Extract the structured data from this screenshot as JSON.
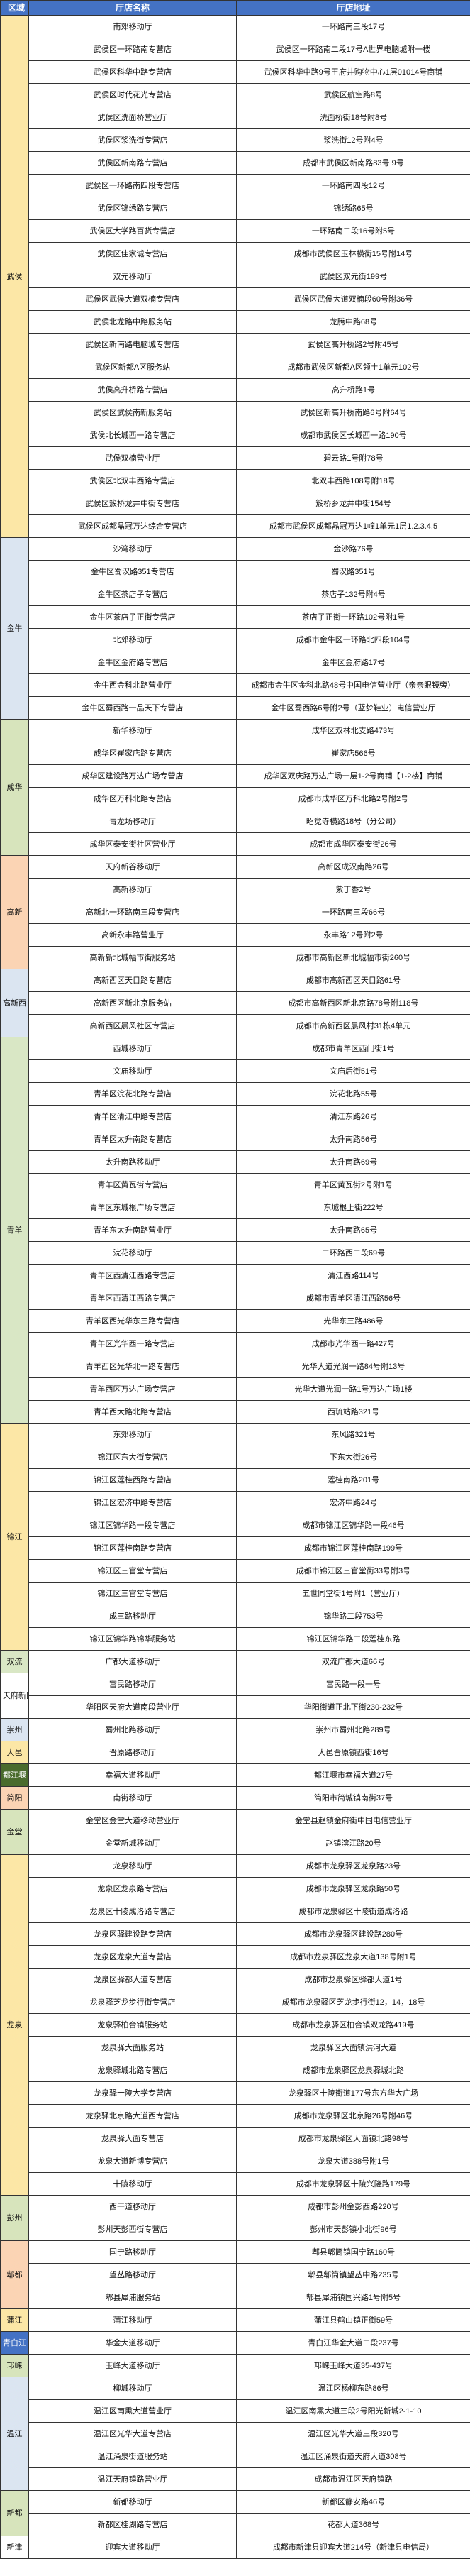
{
  "header": {
    "region": "区域",
    "name": "厅店名称",
    "address": "厅店地址"
  },
  "region_colors": {
    "武侯": "#fce7a6",
    "金牛": "#dbe5f1",
    "成华": "#d7e4bc",
    "高新": "#fbd4b4",
    "高新西": "#dbe5f1",
    "青羊": "#d9e7c5",
    "锦江": "#fce7a6",
    "双流": "#d9e7c5",
    "天府新区": "#ffffff",
    "崇州": "#dbe5f1",
    "大邑": "#fce7a6",
    "都江堰": "#4a6b2d",
    "简阳": "#fbd4b4",
    "金堂": "#d7e4bc",
    "龙泉": "#fce7a6",
    "彭州": "#d7e4bc",
    "郫都": "#fbd4b4",
    "蒲江": "#fce7a6",
    "青白江": "#4472c4",
    "邛崃": "#d7e4bc",
    "温江": "#dbe5f1",
    "新都": "#d7e4bc",
    "新津": "#ffffff"
  },
  "regions": [
    {
      "name": "武侯",
      "stores": [
        [
          "南郊移动厅",
          "一环路南三段17号"
        ],
        [
          "武侯区一环路南专营店",
          "武侯区一环路南二段17号A世界电脑城附一楼"
        ],
        [
          "武侯区科华中路专营店",
          "武侯区科华中路9号王府井购物中心1层01014号商铺"
        ],
        [
          "武侯区时代花光专营店",
          "武侯区航空路8号"
        ],
        [
          "武侯区洗面桥营业厅",
          "洗面桥街18号附8号"
        ],
        [
          "武侯区浆洗街专营店",
          "浆洗街12号附4号"
        ],
        [
          "武侯区新南路专营店",
          "成都市武侯区新南路83号 9号"
        ],
        [
          "武侯区一环路南四段专营店",
          "一环路南四段12号"
        ],
        [
          "武侯区锦绣路专营店",
          "锦绣路65号"
        ],
        [
          "武侯区大学路百货专营店",
          "一环路南二段16号附5号"
        ],
        [
          "武侯区佳家诚专营店",
          "成都市武侯区玉林横街15号附14号"
        ],
        [
          "双元移动厅",
          "武侯区双元街199号"
        ],
        [
          "武侯区武侯大道双楠专营店",
          "武侯区武侯大道双楠段60号附36号"
        ],
        [
          "武侯北龙路中路服务站",
          "龙腾中路68号"
        ],
        [
          "武侯区新南路电脑城专营店",
          "武侯区高升桥路2号附45号"
        ],
        [
          "武侯区新都A区服务站",
          "成都市武侯区新都A区领土1单元102号"
        ],
        [
          "武侯高升桥路专营店",
          "高升桥路1号"
        ],
        [
          "武侯区武侯南新服务站",
          "武侯区新高升桥南路6号附64号"
        ],
        [
          "武侯北长城西一路专营店",
          "成都市武侯区长城西一路190号"
        ],
        [
          "武侯双楠营业厅",
          "碧云路1号附78号"
        ],
        [
          "武侯区北双丰西路专营店",
          "北双丰西路108号附18号"
        ],
        [
          "武侯区簇桥龙井中街专营店",
          "簇桥乡龙井中街154号"
        ],
        [
          "武侯区成都晶冠万达综合专营店",
          "成都市武侯区成都晶冠万达1幢1单元1层1.2.3.4.5"
        ]
      ]
    },
    {
      "name": "金牛",
      "stores": [
        [
          "沙湾移动厅",
          "金沙路76号"
        ],
        [
          "金牛区蜀汉路351专营店",
          "蜀汉路351号"
        ],
        [
          "金牛区茶店子专营店",
          "茶店子132号附4号"
        ],
        [
          "金牛区茶店子正街专营店",
          "茶店子正街一环路102号附1号"
        ],
        [
          "北郊移动厅",
          "成都市金牛区一环路北四段104号"
        ],
        [
          "金牛区金府路专营店",
          "金牛区金府路17号"
        ],
        [
          "金牛西金科北路营业厅",
          "成都市金牛区金科北路48号中国电信营业厅（亲亲眼镜旁）"
        ],
        [
          "金牛区蜀西路一品天下专营店",
          "金牛区蜀西路6号附2号（蓝梦鞋业）电信营业厅"
        ]
      ]
    },
    {
      "name": "成华",
      "stores": [
        [
          "新华移动厅",
          "成华区双林北支路473号"
        ],
        [
          "成华区崔家店路专营店",
          "崔家店566号"
        ],
        [
          "成华区建设路万达广场专营店",
          "成华区双庆路万达广场一层1-2号商铺【1-2楼】商铺"
        ],
        [
          "成华区万科北路专营店",
          "成都市成华区万科北路2号附2号"
        ],
        [
          "青龙场移动厅",
          "昭觉寺横路18号（分公司）"
        ],
        [
          "成华区泰安街社区营业厅",
          "成都市成华区泰安街26号"
        ]
      ]
    },
    {
      "name": "高新",
      "stores": [
        [
          "天府新谷移动厅",
          "高新区成汉南路26号"
        ],
        [
          "高新移动厅",
          "紫丁香2号"
        ],
        [
          "高新北一环路南三段专营店",
          "一环路南三段66号"
        ],
        [
          "高新永丰路营业厅",
          "永丰路12号附2号"
        ],
        [
          "高新新北城幅市街服务站",
          "成都市高新区新北城幅市街260号"
        ]
      ]
    },
    {
      "name": "高新西",
      "stores": [
        [
          "高新西区天目路专营店",
          "成都市高新西区天目路61号"
        ],
        [
          "高新西区新北京服务站",
          "成都市高新西区新北京路78号附118号"
        ],
        [
          "高新西区晨风社区专营店",
          "成都市高新西区晨风村31栋4单元"
        ]
      ]
    },
    {
      "name": "青羊",
      "stores": [
        [
          "西城移动厅",
          "成都市青羊区西门街1号"
        ],
        [
          "文庙移动厅",
          "文庙后街51号"
        ],
        [
          "青羊区浣花北路专营店",
          "浣花北路55号"
        ],
        [
          "青羊区清江中路专营店",
          "清江东路26号"
        ],
        [
          "青羊区太升南路专营店",
          "太升南路56号"
        ],
        [
          "太升南路移动厅",
          "太升南路69号"
        ],
        [
          "青羊区黄瓦街专营店",
          "青羊区黄瓦街2号附1号"
        ],
        [
          "青羊区东城根广场专营店",
          "东城根上街222号"
        ],
        [
          "青羊东太升南路营业厅",
          "太升南路65号"
        ],
        [
          "浣花移动厅",
          "二环路西二段69号"
        ],
        [
          "青羊区西清江西路专营店",
          "清江西路114号"
        ],
        [
          "青羊区西清江西路专营店",
          "成都市青羊区清江西路56号"
        ],
        [
          "青羊区西光华东三路专营店",
          "光华东三路486号"
        ],
        [
          "青羊区光华西一路专营店",
          "成都市光华西一路427号"
        ],
        [
          "青羊西区光华北一路专营店",
          "光华大道光润一路84号附13号"
        ],
        [
          "青羊西区万达广场专营店",
          "光华大道光润一路1号万达广场1楼"
        ],
        [
          "青羊西大路北路专营店",
          "西琉站路321号"
        ]
      ]
    },
    {
      "name": "锦江",
      "stores": [
        [
          "东郊移动厅",
          "东风路321号"
        ],
        [
          "锦江区东大街专营店",
          "下东大街26号"
        ],
        [
          "锦江区莲桂西路专营店",
          "莲桂南路201号"
        ],
        [
          "锦江区宏济中路专营店",
          "宏济中路24号"
        ],
        [
          "锦江区锦华路一段专营店",
          "成都市锦江区锦华路一段46号"
        ],
        [
          "锦江区莲桂南路专营店",
          "成都市锦江区莲桂南路199号"
        ],
        [
          "锦江区三官堂专营店",
          "成都市锦江区三官堂街33号附3号"
        ],
        [
          "锦江区三官堂专营店",
          "五世同堂街1号附1（营业厅）"
        ],
        [
          "成三路移动厅",
          "锦华路二段753号"
        ],
        [
          "锦江区锦华路锦华服务站",
          "锦江区锦华路二段莲桂东路"
        ]
      ]
    },
    {
      "name": "双流",
      "stores": [
        [
          "广都大道移动厅",
          "双流广都大道66号"
        ]
      ]
    },
    {
      "name": "天府新区",
      "stores": [
        [
          "富民路移动厅",
          "富民路一段一号"
        ],
        [
          "华阳区天府大道南段营业厅",
          "华阳街道正北下街230-232号"
        ]
      ]
    },
    {
      "name": "崇州",
      "stores": [
        [
          "蜀州北路移动厅",
          "崇州市蜀州北路289号"
        ]
      ]
    },
    {
      "name": "大邑",
      "stores": [
        [
          "晋原路移动厅",
          "大邑晋原镇西街16号"
        ]
      ]
    },
    {
      "name": "都江堰",
      "stores": [
        [
          "幸福大道移动厅",
          "都江堰市幸福大道27号"
        ]
      ]
    },
    {
      "name": "简阳",
      "stores": [
        [
          "南街移动厅",
          "简阳市简城镇南街37号"
        ]
      ]
    },
    {
      "name": "金堂",
      "stores": [
        [
          "金堂区金堂大道移动营业厅",
          "金堂县赵镇金府街中国电信营业厅"
        ],
        [
          "金堂新城移动厅",
          "赵镇滨江路20号"
        ]
      ]
    },
    {
      "name": "龙泉",
      "stores": [
        [
          "龙泉移动厅",
          "成都市龙泉驿区龙泉路23号"
        ],
        [
          "龙泉区龙泉路专营店",
          "成都市龙泉驿区龙泉路50号"
        ],
        [
          "龙泉区十陵成洛路专营店",
          "成都市龙泉驿区十陵街道成洛路"
        ],
        [
          "龙泉区驿建设路专营店",
          "成都市龙泉驿区建设路280号"
        ],
        [
          "龙泉区龙泉大道专营店",
          "成都市龙泉驿区龙泉大道138号附1号"
        ],
        [
          "龙泉区驿都大道专营店",
          "成都市龙泉驿区驿都大道1号"
        ],
        [
          "龙泉驿芝龙步行街专营店",
          "成都市龙泉驿区芝龙步行街12，14，18号"
        ],
        [
          "龙泉驿柏合镇服务站",
          "成都市龙泉驿区柏合镇双龙路419号"
        ],
        [
          "龙泉驿大面服务站",
          "龙泉驿区大面镇洪河大道"
        ],
        [
          "龙泉驿城北路专营店",
          "成都市龙泉驿区龙泉驿城北路"
        ],
        [
          "龙泉驿十陵大学专营店",
          "龙泉驿区十陵街道177号东方华大广场"
        ],
        [
          "龙泉驿北京路大道西专营店",
          "成都市龙泉驿区北京路26号附46号"
        ],
        [
          "龙泉驿大面专营店",
          "成都市龙泉驿区大面镇北路98号"
        ],
        [
          "龙泉大道新博专营店",
          "龙泉大道388号附1号"
        ],
        [
          "十陵移动厅",
          "成都市龙泉驿区十陵兴隆路179号"
        ]
      ]
    },
    {
      "name": "彭州",
      "stores": [
        [
          "西干道移动厅",
          "成都市彭州金彭西路220号"
        ],
        [
          "彭州天彭西街专营店",
          "彭州市天彭镇小北街96号"
        ]
      ]
    },
    {
      "name": "郫都",
      "stores": [
        [
          "国宁路移动厅",
          "郫县郫筒镇国宁路160号"
        ],
        [
          "望丛路移动厅",
          "郫县郫筒镇望丛中路235号"
        ],
        [
          "郫县犀浦服务站",
          "郫县犀浦镇国兴路1号附5号"
        ]
      ]
    },
    {
      "name": "蒲江",
      "stores": [
        [
          "蒲江移动厅",
          "蒲江县鹤山镇正街59号"
        ]
      ]
    },
    {
      "name": "青白江",
      "stores": [
        [
          "华金大道移动厅",
          "青白江华金大道二段237号"
        ]
      ]
    },
    {
      "name": "邛崃",
      "stores": [
        [
          "玉峰大道移动厅",
          "邛崃玉峰大道35-437号"
        ]
      ]
    },
    {
      "name": "温江",
      "stores": [
        [
          "柳城移动厅",
          "温江区杨柳东路86号"
        ],
        [
          "温江区南熏大道营业厅",
          "温江区南熏大道三段2号阳光新城2-1-10"
        ],
        [
          "温江区光华大道专营店",
          "温江区光华大道三段320号"
        ],
        [
          "温江涌泉街道服务站",
          "温江区涌泉街道天府大道308号"
        ],
        [
          "温江天府镇路营业厅",
          "成都市温江区天府镇路"
        ]
      ]
    },
    {
      "name": "新都",
      "stores": [
        [
          "新都移动厅",
          "新都区静安路46号"
        ],
        [
          "新都区桂湖路专营店",
          "花都大道368号"
        ]
      ]
    },
    {
      "name": "新津",
      "stores": [
        [
          "迎宾大道移动厅",
          "成都市新津县迎宾大道214号（新津县电信局）"
        ]
      ]
    }
  ]
}
